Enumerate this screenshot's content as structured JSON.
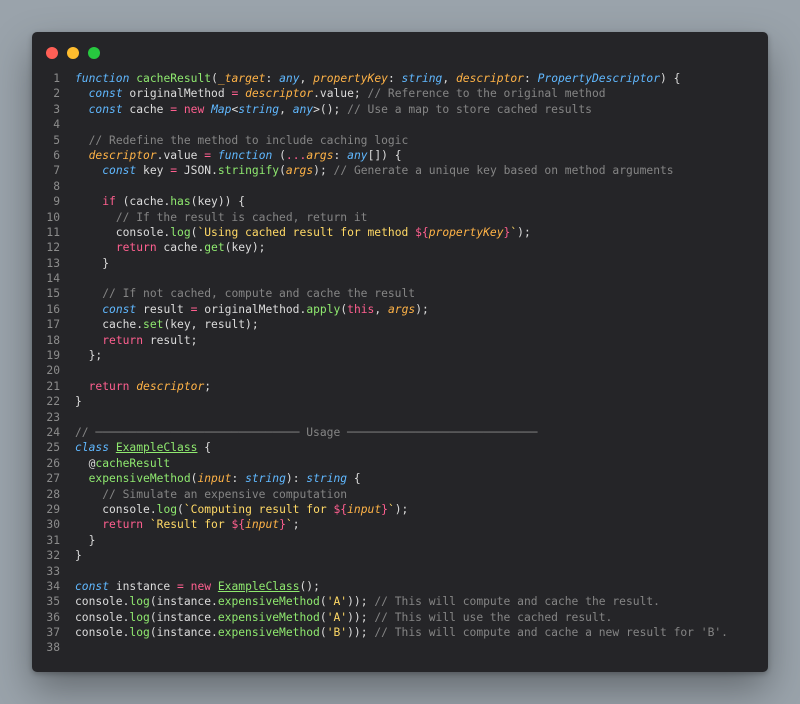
{
  "window": {
    "controls": [
      {
        "name": "close-button",
        "color": "#ff5f56"
      },
      {
        "name": "minimize-button",
        "color": "#ffbd2e"
      },
      {
        "name": "maximize-button",
        "color": "#27c93f"
      }
    ]
  },
  "code": {
    "lines": [
      [
        [
          "kwi",
          "function"
        ],
        [
          "var",
          " "
        ],
        [
          "fn",
          "cacheResult"
        ],
        [
          "punc",
          "("
        ],
        [
          "param",
          "_target"
        ],
        [
          "punc",
          ": "
        ],
        [
          "type",
          "any"
        ],
        [
          "punc",
          ", "
        ],
        [
          "param",
          "propertyKey"
        ],
        [
          "punc",
          ": "
        ],
        [
          "type",
          "string"
        ],
        [
          "punc",
          ", "
        ],
        [
          "param",
          "descriptor"
        ],
        [
          "punc",
          ": "
        ],
        [
          "type",
          "PropertyDescriptor"
        ],
        [
          "punc",
          ") {"
        ]
      ],
      [
        [
          "var",
          "  "
        ],
        [
          "kwi",
          "const"
        ],
        [
          "var",
          " originalMethod "
        ],
        [
          "op",
          "="
        ],
        [
          "var",
          " "
        ],
        [
          "param",
          "descriptor"
        ],
        [
          "punc",
          "."
        ],
        [
          "prop",
          "value"
        ],
        [
          "punc",
          "; "
        ],
        [
          "cmt",
          "// Reference to the original method"
        ]
      ],
      [
        [
          "var",
          "  "
        ],
        [
          "kwi",
          "const"
        ],
        [
          "var",
          " cache "
        ],
        [
          "op",
          "="
        ],
        [
          "var",
          " "
        ],
        [
          "kw",
          "new"
        ],
        [
          "var",
          " "
        ],
        [
          "type",
          "Map"
        ],
        [
          "punc",
          "<"
        ],
        [
          "type",
          "string"
        ],
        [
          "punc",
          ", "
        ],
        [
          "type",
          "any"
        ],
        [
          "punc",
          ">(); "
        ],
        [
          "cmt",
          "// Use a map to store cached results"
        ]
      ],
      [],
      [
        [
          "var",
          "  "
        ],
        [
          "cmt",
          "// Redefine the method to include caching logic"
        ]
      ],
      [
        [
          "var",
          "  "
        ],
        [
          "param",
          "descriptor"
        ],
        [
          "punc",
          "."
        ],
        [
          "prop",
          "value"
        ],
        [
          "var",
          " "
        ],
        [
          "op",
          "="
        ],
        [
          "var",
          " "
        ],
        [
          "kwi",
          "function"
        ],
        [
          "var",
          " ("
        ],
        [
          "op",
          "..."
        ],
        [
          "param",
          "args"
        ],
        [
          "punc",
          ": "
        ],
        [
          "type",
          "any"
        ],
        [
          "punc",
          "[]) {"
        ]
      ],
      [
        [
          "var",
          "    "
        ],
        [
          "kwi",
          "const"
        ],
        [
          "var",
          " key "
        ],
        [
          "op",
          "="
        ],
        [
          "var",
          " JSON"
        ],
        [
          "punc",
          "."
        ],
        [
          "fn",
          "stringify"
        ],
        [
          "punc",
          "("
        ],
        [
          "param",
          "args"
        ],
        [
          "punc",
          "); "
        ],
        [
          "cmt",
          "// Generate a unique key based on method arguments"
        ]
      ],
      [],
      [
        [
          "var",
          "    "
        ],
        [
          "kw",
          "if"
        ],
        [
          "var",
          " (cache"
        ],
        [
          "punc",
          "."
        ],
        [
          "fn",
          "has"
        ],
        [
          "punc",
          "(key)) {"
        ]
      ],
      [
        [
          "var",
          "      "
        ],
        [
          "cmt",
          "// If the result is cached, return it"
        ]
      ],
      [
        [
          "var",
          "      console"
        ],
        [
          "punc",
          "."
        ],
        [
          "fn",
          "log"
        ],
        [
          "punc",
          "("
        ],
        [
          "str",
          "`Using cached result for method "
        ],
        [
          "kw",
          "${"
        ],
        [
          "param",
          "propertyKey"
        ],
        [
          "kw",
          "}"
        ],
        [
          "str",
          "`"
        ],
        [
          "punc",
          ");"
        ]
      ],
      [
        [
          "var",
          "      "
        ],
        [
          "kw",
          "return"
        ],
        [
          "var",
          " cache"
        ],
        [
          "punc",
          "."
        ],
        [
          "fn",
          "get"
        ],
        [
          "punc",
          "(key);"
        ]
      ],
      [
        [
          "var",
          "    "
        ],
        [
          "punc",
          "}"
        ]
      ],
      [],
      [
        [
          "var",
          "    "
        ],
        [
          "cmt",
          "// If not cached, compute and cache the result"
        ]
      ],
      [
        [
          "var",
          "    "
        ],
        [
          "kwi",
          "const"
        ],
        [
          "var",
          " result "
        ],
        [
          "op",
          "="
        ],
        [
          "var",
          " originalMethod"
        ],
        [
          "punc",
          "."
        ],
        [
          "fn",
          "apply"
        ],
        [
          "punc",
          "("
        ],
        [
          "this",
          "this"
        ],
        [
          "punc",
          ", "
        ],
        [
          "param",
          "args"
        ],
        [
          "punc",
          ");"
        ]
      ],
      [
        [
          "var",
          "    cache"
        ],
        [
          "punc",
          "."
        ],
        [
          "fn",
          "set"
        ],
        [
          "punc",
          "(key, result);"
        ]
      ],
      [
        [
          "var",
          "    "
        ],
        [
          "kw",
          "return"
        ],
        [
          "var",
          " result"
        ],
        [
          "punc",
          ";"
        ]
      ],
      [
        [
          "var",
          "  "
        ],
        [
          "punc",
          "};"
        ]
      ],
      [],
      [
        [
          "var",
          "  "
        ],
        [
          "kw",
          "return"
        ],
        [
          "var",
          " "
        ],
        [
          "param",
          "descriptor"
        ],
        [
          "punc",
          ";"
        ]
      ],
      [
        [
          "punc",
          "}"
        ]
      ],
      [],
      [
        [
          "cmt",
          "// ────────────────────────────── Usage ────────────────────────────"
        ]
      ],
      [
        [
          "kwi",
          "class"
        ],
        [
          "var",
          " "
        ],
        [
          "cls",
          "ExampleClass"
        ],
        [
          "var",
          " "
        ],
        [
          "punc",
          "{"
        ]
      ],
      [
        [
          "var",
          "  "
        ],
        [
          "punc",
          "@"
        ],
        [
          "dec",
          "cacheResult"
        ]
      ],
      [
        [
          "var",
          "  "
        ],
        [
          "fn",
          "expensiveMethod"
        ],
        [
          "punc",
          "("
        ],
        [
          "param",
          "input"
        ],
        [
          "punc",
          ": "
        ],
        [
          "type",
          "string"
        ],
        [
          "punc",
          "): "
        ],
        [
          "type",
          "string"
        ],
        [
          "var",
          " "
        ],
        [
          "punc",
          "{"
        ]
      ],
      [
        [
          "var",
          "    "
        ],
        [
          "cmt",
          "// Simulate an expensive computation"
        ]
      ],
      [
        [
          "var",
          "    console"
        ],
        [
          "punc",
          "."
        ],
        [
          "fn",
          "log"
        ],
        [
          "punc",
          "("
        ],
        [
          "str",
          "`Computing result for "
        ],
        [
          "kw",
          "${"
        ],
        [
          "param",
          "input"
        ],
        [
          "kw",
          "}"
        ],
        [
          "str",
          "`"
        ],
        [
          "punc",
          ");"
        ]
      ],
      [
        [
          "var",
          "    "
        ],
        [
          "kw",
          "return"
        ],
        [
          "var",
          " "
        ],
        [
          "str",
          "`Result for "
        ],
        [
          "kw",
          "${"
        ],
        [
          "param",
          "input"
        ],
        [
          "kw",
          "}"
        ],
        [
          "str",
          "`"
        ],
        [
          "punc",
          ";"
        ]
      ],
      [
        [
          "var",
          "  "
        ],
        [
          "punc",
          "}"
        ]
      ],
      [
        [
          "punc",
          "}"
        ]
      ],
      [],
      [
        [
          "kwi",
          "const"
        ],
        [
          "var",
          " instance "
        ],
        [
          "op",
          "="
        ],
        [
          "var",
          " "
        ],
        [
          "kw",
          "new"
        ],
        [
          "var",
          " "
        ],
        [
          "cls",
          "ExampleClass"
        ],
        [
          "punc",
          "();"
        ]
      ],
      [
        [
          "var",
          "console"
        ],
        [
          "punc",
          "."
        ],
        [
          "fn",
          "log"
        ],
        [
          "punc",
          "(instance."
        ],
        [
          "fn",
          "expensiveMethod"
        ],
        [
          "punc",
          "("
        ],
        [
          "str",
          "'A'"
        ],
        [
          "punc",
          "));"
        ],
        [
          "var",
          " "
        ],
        [
          "cmt",
          "// This will compute and cache the result."
        ]
      ],
      [
        [
          "var",
          "console"
        ],
        [
          "punc",
          "."
        ],
        [
          "fn",
          "log"
        ],
        [
          "punc",
          "(instance."
        ],
        [
          "fn",
          "expensiveMethod"
        ],
        [
          "punc",
          "("
        ],
        [
          "str",
          "'A'"
        ],
        [
          "punc",
          "));"
        ],
        [
          "var",
          " "
        ],
        [
          "cmt",
          "// This will use the cached result."
        ]
      ],
      [
        [
          "var",
          "console"
        ],
        [
          "punc",
          "."
        ],
        [
          "fn",
          "log"
        ],
        [
          "punc",
          "(instance."
        ],
        [
          "fn",
          "expensiveMethod"
        ],
        [
          "punc",
          "("
        ],
        [
          "str",
          "'B'"
        ],
        [
          "punc",
          "));"
        ],
        [
          "var",
          " "
        ],
        [
          "cmt",
          "// This will compute and cache a new result for 'B'."
        ]
      ],
      []
    ]
  }
}
